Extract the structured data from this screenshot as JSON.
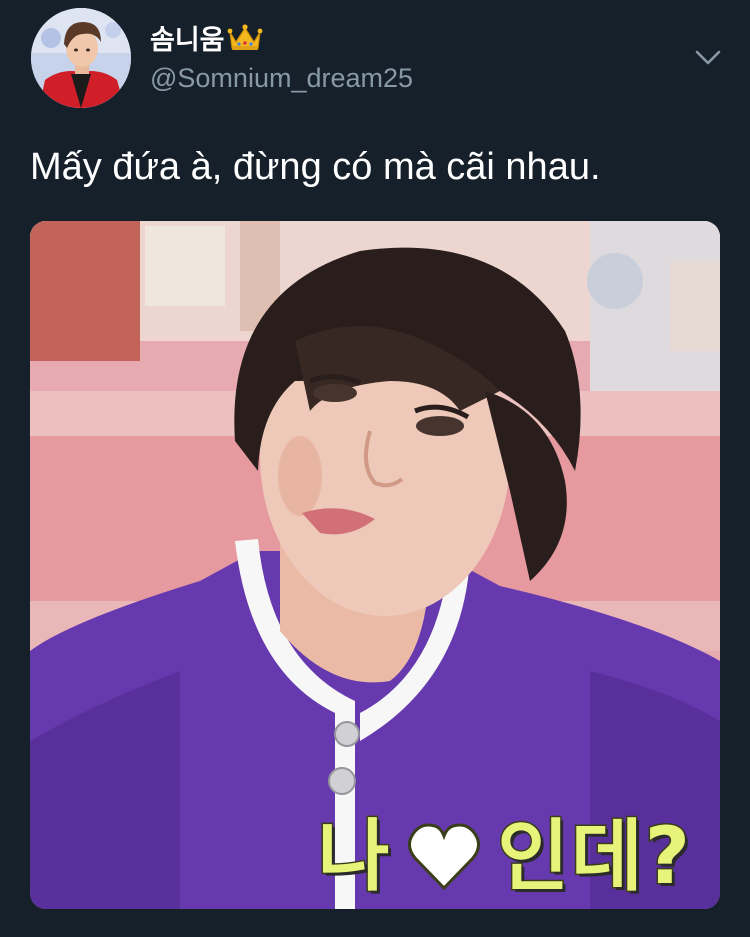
{
  "tweet": {
    "display_name": "솜니움",
    "handle": "@Somnium_dream25",
    "text": "Mấy đứa à, đừng có mà cãi nhau.",
    "name_badge_icon": "crown-emoji-icon",
    "menu_icon": "chevron-down-icon"
  },
  "media": {
    "caption_left": "나",
    "caption_icon": "heart-icon",
    "caption_right": "인데?"
  },
  "colors": {
    "background": "#15202b",
    "name": "#ffffff",
    "handle": "#8899a6",
    "caption": "#e8f37a"
  }
}
